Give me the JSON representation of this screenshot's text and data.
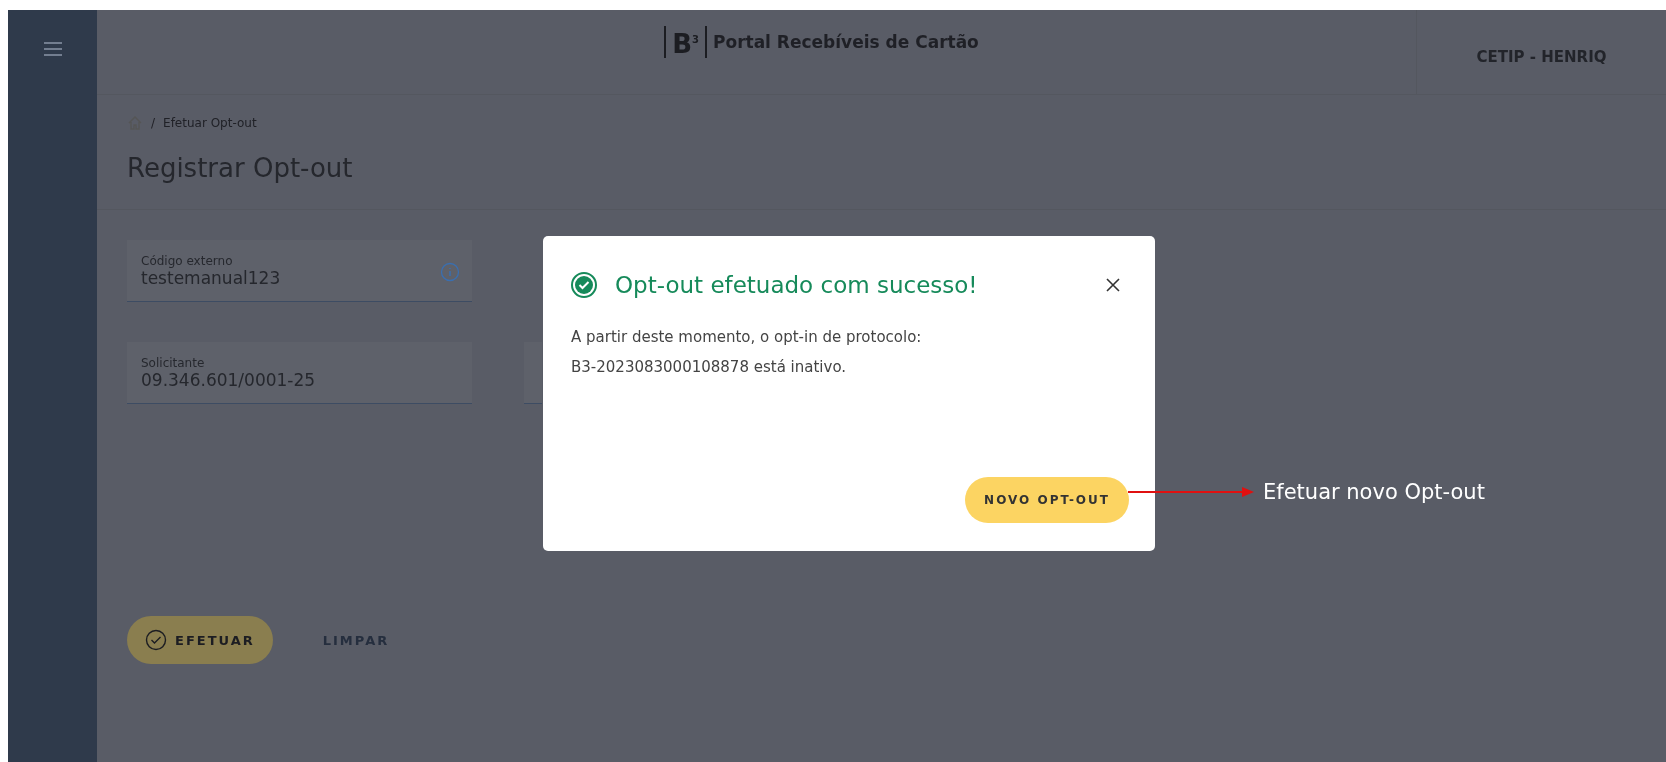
{
  "header": {
    "logo": "B",
    "logo_sup": "3",
    "title": "Portal Recebíveis de Cartão",
    "user": "CETIP - HENRIQ"
  },
  "breadcrumb_separator": "/",
  "breadcrumb": [
    "Efetuar Opt-out"
  ],
  "page_title": "Registrar Opt-out",
  "fields": [
    {
      "label": "Código externo",
      "value": "testemanual123",
      "info": true
    },
    {
      "label": "Solicitante",
      "value": "09.346.601/0001-25",
      "info": false
    }
  ],
  "buttons": [
    {
      "label": "EFETUAR",
      "kind": "primary"
    },
    {
      "label": "LIMPAR",
      "kind": "text"
    }
  ],
  "modal": {
    "title": "Opt-out efetuado com sucesso!",
    "lines": [
      "A partir deste momento, o opt-in de protocolo:",
      "B3-2023083000108878 está inativo."
    ],
    "button": "NOVO OPT-OUT"
  },
  "annotation": "Efetuar novo Opt-out"
}
